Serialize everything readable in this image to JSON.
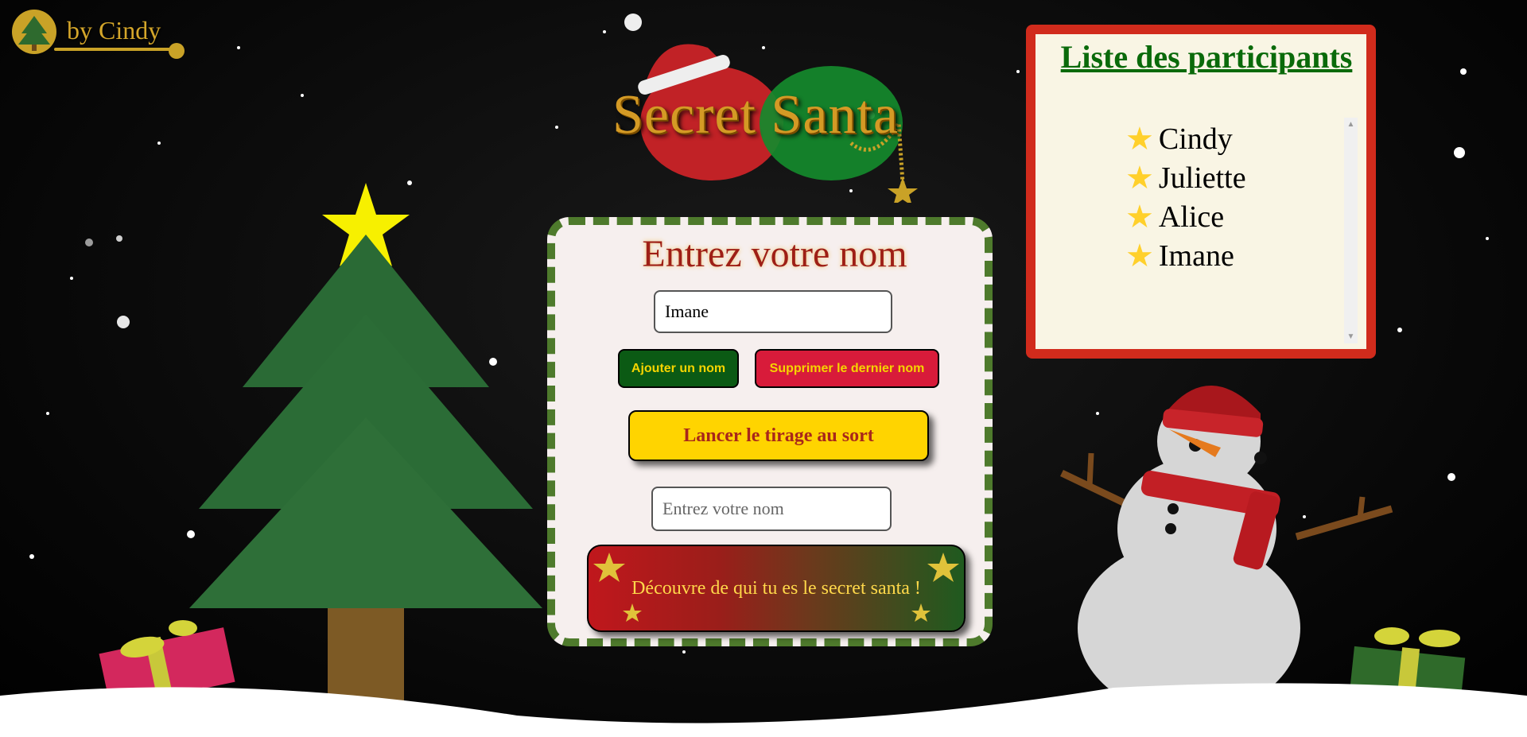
{
  "logo": {
    "text": "by Cindy"
  },
  "header": {
    "title": "Secret Santa"
  },
  "form": {
    "title": "Entrez votre nom",
    "name_input_value": "Imane",
    "add_button": "Ajouter un nom",
    "remove_button": "Supprimer le dernier nom",
    "draw_button": "Lancer le tirage au sort",
    "reveal_input_placeholder": "Entrez votre nom",
    "reveal_button": "Découvre de qui tu es le secret santa !"
  },
  "participants": {
    "title": "Liste des participants",
    "items": [
      "Cindy",
      "Juliette",
      "Alice",
      "Imane"
    ]
  },
  "colors": {
    "green": "#0b5a14",
    "red": "#d81b3a",
    "yellow": "#ffd400",
    "panel_border": "#4e7a2c",
    "list_border": "#d12b1c"
  }
}
